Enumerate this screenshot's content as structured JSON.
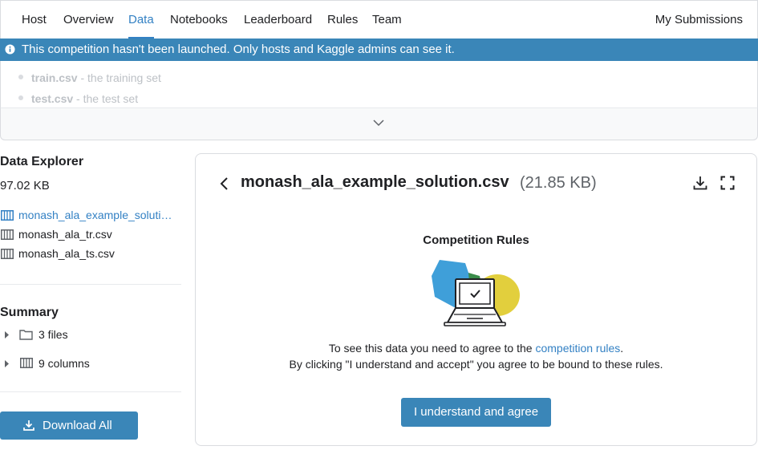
{
  "nav": {
    "tabs": [
      "Host",
      "Overview",
      "Data",
      "Notebooks",
      "Leaderboard",
      "Rules",
      "Team"
    ],
    "active_tab": "Data",
    "my_submissions": "My Submissions"
  },
  "banner": {
    "text": "This competition hasn't been launched. Only hosts and Kaggle admins can see it.",
    "color": "#3a86b8"
  },
  "description": {
    "items": [
      {
        "name": "train.csv",
        "text": " - the training set"
      },
      {
        "name": "test.csv",
        "text": " - the test set"
      }
    ]
  },
  "sidebar": {
    "title": "Data Explorer",
    "total_size": "97.02 KB",
    "files": [
      {
        "label": "monash_ala_example_solution.csv",
        "active": true
      },
      {
        "label": "monash_ala_tr.csv",
        "active": false
      },
      {
        "label": "monash_ala_ts.csv",
        "active": false
      }
    ],
    "summary_title": "Summary",
    "summary": [
      {
        "label": "3 files",
        "icon": "folder-icon"
      },
      {
        "label": "9 columns",
        "icon": "table-icon"
      }
    ],
    "download_all": "Download All"
  },
  "panel": {
    "file_name": "monash_ala_example_solution.csv",
    "file_size": "(21.85 KB)",
    "rules_title": "Competition Rules",
    "line1_prefix": "To see this data you need to agree to the ",
    "line1_link": "competition rules",
    "line1_suffix": ".",
    "line2": "By clicking \"I understand and accept\" you agree to be bound to these rules.",
    "agree_button": "I understand and agree"
  },
  "colors": {
    "accent": "#3381c4",
    "button": "#3a86b8"
  }
}
